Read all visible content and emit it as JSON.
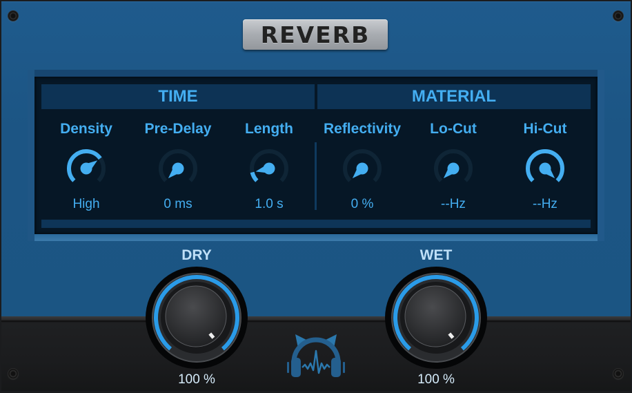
{
  "title": "REVERB",
  "colors": {
    "accent": "#44aef1",
    "panel_blue": "#1c5584",
    "screen_bg": "#061726",
    "track_off": "#0f2536",
    "bottom_panel": "#1b1c1e"
  },
  "sections": [
    {
      "label": "TIME"
    },
    {
      "label": "MATERIAL"
    }
  ],
  "params": [
    {
      "label": "Density",
      "value": "High",
      "position": 0.7,
      "icon": "gauge-knob"
    },
    {
      "label": "Pre-Delay",
      "value": "0 ms",
      "position": 0.0,
      "icon": "gauge-knob"
    },
    {
      "label": "Length",
      "value": "1.0 s",
      "position": 0.12,
      "icon": "gauge-knob"
    },
    {
      "label": "Reflectivity",
      "value": "0 %",
      "position": 0.0,
      "icon": "gauge-knob"
    },
    {
      "label": "Lo-Cut",
      "value": "--Hz",
      "position": 0.0,
      "icon": "gauge-knob"
    },
    {
      "label": "Hi-Cut",
      "value": "--Hz",
      "position": 1.0,
      "icon": "gauge-knob"
    }
  ],
  "mix": {
    "dry": {
      "label": "DRY",
      "value": "100 %",
      "position": 1.0
    },
    "wet": {
      "label": "WET",
      "value": "100 %",
      "position": 1.0
    }
  },
  "logo": {
    "icon": "cat-headphones-logo-icon"
  }
}
